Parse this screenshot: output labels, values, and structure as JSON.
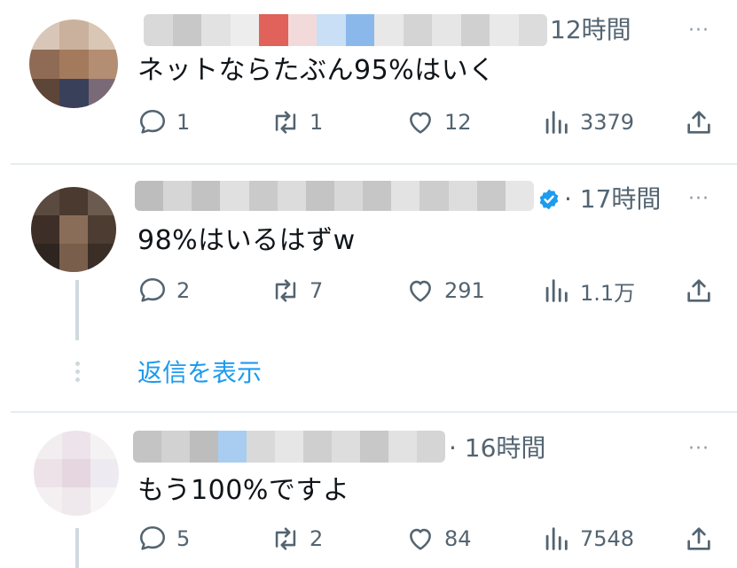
{
  "tweets": [
    {
      "time": "12時間",
      "text": "ネットならたぶん95%はいく",
      "replies": "1",
      "retweets": "1",
      "likes": "12",
      "views": "3379"
    },
    {
      "time": "· 17時間",
      "text": "98%はいるはずw",
      "replies": "2",
      "retweets": "7",
      "likes": "291",
      "views": "1.1万"
    },
    {
      "time": "· 16時間",
      "text": "もう100%ですよ",
      "replies": "5",
      "retweets": "2",
      "likes": "84",
      "views": "7548"
    }
  ],
  "show_replies_label": "返信を表示",
  "more_label": "···",
  "colors": {
    "accent": "#1d9bf0",
    "secondary_text": "#536471",
    "divider": "#e6ecf0"
  },
  "icons": [
    "reply-icon",
    "retweet-icon",
    "like-icon",
    "views-icon",
    "share-icon",
    "verified-badge-icon",
    "more-icon"
  ]
}
